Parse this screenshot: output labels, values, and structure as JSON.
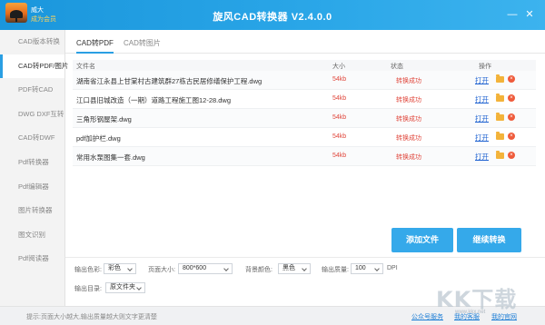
{
  "titlebar": {
    "title": "旋风CAD转换器 V2.4.0.0",
    "user_name": "威大",
    "user_vip": "成为会员",
    "minimize": "—",
    "close": "✕"
  },
  "sidebar": {
    "items": [
      {
        "label": "CAD版本转换",
        "active": false
      },
      {
        "label": "CAD转PDF/图片",
        "active": true
      },
      {
        "label": "PDF转CAD",
        "active": false
      },
      {
        "label": "DWG DXF互转",
        "active": false
      },
      {
        "label": "CAD转DWF",
        "active": false
      },
      {
        "label": "Pdf转换器",
        "active": false
      },
      {
        "label": "Pdf编辑器",
        "active": false
      },
      {
        "label": "图片转换器",
        "active": false
      },
      {
        "label": "图文识别",
        "active": false
      },
      {
        "label": "Pdf阅读器",
        "active": false
      }
    ]
  },
  "tabs": [
    "CAD转PDF",
    "CAD转图片"
  ],
  "table": {
    "headers": {
      "name": "文件名",
      "size": "大小",
      "status": "状态",
      "op": "操作"
    },
    "rows": [
      {
        "name": "湖南省江永县上甘棠村古建筑群27栋古民居修缮保护工程.dwg",
        "size": "54kb",
        "status": "转换成功",
        "open": "打开"
      },
      {
        "name": "江口县旧城改造（一期）道路工程施工图12-28.dwg",
        "size": "54kb",
        "status": "转换成功",
        "open": "打开"
      },
      {
        "name": "三角形钢屋架.dwg",
        "size": "54kb",
        "status": "转换成功",
        "open": "打开"
      },
      {
        "name": "pdf加护栏.dwg",
        "size": "54kb",
        "status": "转换成功",
        "open": "打开"
      },
      {
        "name": "常用水泵图集一套.dwg",
        "size": "54kb",
        "status": "转换成功",
        "open": "打开"
      }
    ]
  },
  "buttons": {
    "add": "添加文件",
    "convert": "继续转换"
  },
  "settings": {
    "color_label": "输出色彩:",
    "color_value": "彩色",
    "page_label": "页面大小:",
    "page_value": "800*600",
    "bg_label": "背景颜色:",
    "bg_value": "黑色",
    "quality_label": "输出质量:",
    "quality_value": "100",
    "quality_unit": "DPI",
    "dir_label": "输出目录:",
    "dir_value": "原文件夹"
  },
  "statusbar": {
    "tip": "提示:页面大小越大,输出质量越大则文字更清楚",
    "links": [
      "公众号服务",
      "我的客服",
      "我的官网"
    ]
  },
  "watermark": {
    "text": "KK下载",
    "url": "www.kkx.net"
  },
  "colors": {
    "accent": "#2a9fe3",
    "error": "#e0463b",
    "link": "#1a5fd0"
  }
}
